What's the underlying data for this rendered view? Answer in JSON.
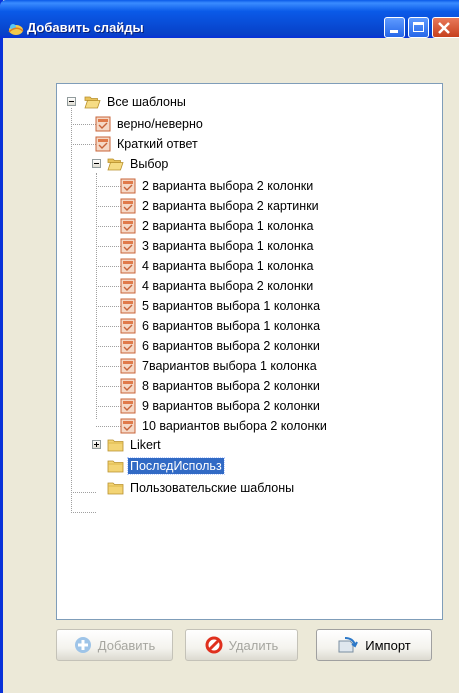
{
  "window": {
    "title": "Добавить слайды",
    "accent": "#0a5ae8"
  },
  "tree": {
    "root": {
      "label": "Все шаблоны",
      "expanded": true
    },
    "items": [
      {
        "id": "n1",
        "label": "верно/неверно",
        "type": "file"
      },
      {
        "id": "n2",
        "label": "Краткий ответ",
        "type": "file"
      },
      {
        "id": "n3",
        "label": "Выбор",
        "type": "folder",
        "expanded": true
      },
      {
        "id": "n4",
        "label": "2 варианта выбора 2 колонки",
        "type": "file"
      },
      {
        "id": "n5",
        "label": "2 варианта выбора 2 картинки",
        "type": "file"
      },
      {
        "id": "n6",
        "label": "2 варианта выбора 1 колонка",
        "type": "file"
      },
      {
        "id": "n7",
        "label": "3 варианта выбора 1 колонка",
        "type": "file"
      },
      {
        "id": "n8",
        "label": "4 варианта выбора 1 колонка",
        "type": "file"
      },
      {
        "id": "n9",
        "label": "4 варианта выбора 2 колонки",
        "type": "file"
      },
      {
        "id": "n10",
        "label": "5 вариантов выбора 1 колонка",
        "type": "file"
      },
      {
        "id": "n11",
        "label": "6 вариантов выбора 1 колонка",
        "type": "file"
      },
      {
        "id": "n12",
        "label": "6 вариантов выбора 2 колонки",
        "type": "file"
      },
      {
        "id": "n13",
        "label": "7вариантов выбора 1 колонка",
        "type": "file"
      },
      {
        "id": "n14",
        "label": "8 вариантов выбора 2 колонки",
        "type": "file"
      },
      {
        "id": "n15",
        "label": "9 вариантов выбора 2 колонки",
        "type": "file"
      },
      {
        "id": "n16",
        "label": "10 вариантов выбора 2 колонки",
        "type": "file"
      },
      {
        "id": "n17",
        "label": "Likert",
        "type": "folder",
        "expanded": false
      },
      {
        "id": "n18",
        "label": "ПоследИспольз",
        "type": "folder",
        "selected": true
      },
      {
        "id": "n19",
        "label": "Пользовательские шаблоны",
        "type": "folder"
      }
    ]
  },
  "buttons": {
    "add_label": "Добавить",
    "delete_label": "Удалить",
    "import_label": "Импорт"
  }
}
